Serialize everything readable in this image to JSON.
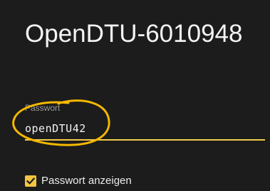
{
  "dialog": {
    "title": "OpenDTU-6010948"
  },
  "password_field": {
    "label": "Passwort",
    "value": "openDTU42"
  },
  "show_password": {
    "label": "Passwort anzeigen",
    "checked": true
  },
  "colors": {
    "background": "#1c1c1c",
    "accent": "#f5c542",
    "annotation": "#f5b800"
  },
  "icons": {
    "checkbox": "checkmark-icon"
  }
}
